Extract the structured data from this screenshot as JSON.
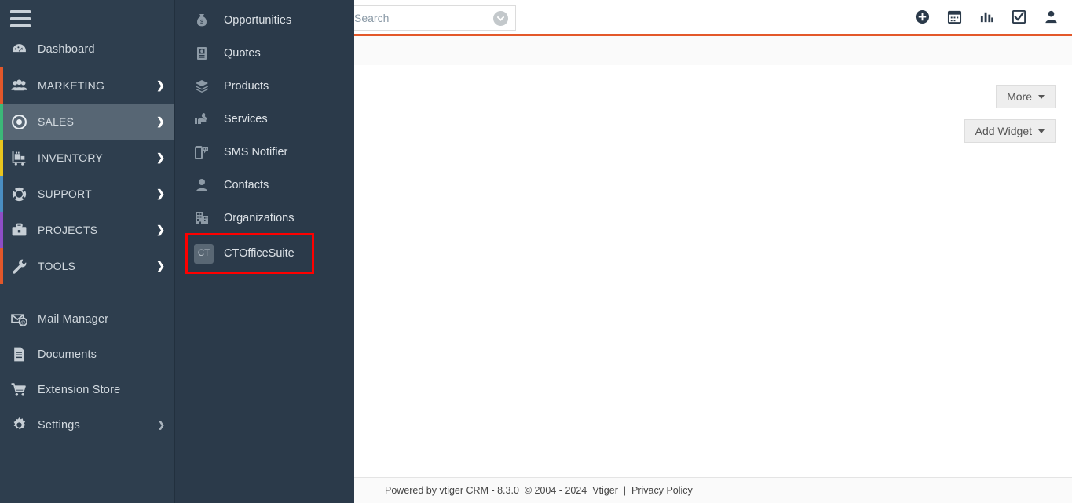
{
  "colors": {
    "accent_orange": "#e3582a",
    "sidebar_bg": "#2e3e4e",
    "submenu_bg": "#2b3a4a",
    "active_item_bg": "#576674",
    "highlight_box": "#ff0000"
  },
  "header": {
    "search": {
      "placeholder": "Search",
      "value": "",
      "visible_text": "arch",
      "dropdown_icon": "chevron-down-circle-icon"
    },
    "icons": [
      {
        "name": "add-record-icon",
        "title": "Add"
      },
      {
        "name": "calendar-icon",
        "title": "Calendar"
      },
      {
        "name": "analytics-icon",
        "title": "Analytics"
      },
      {
        "name": "tasks-checkbox-icon",
        "title": "Tasks"
      },
      {
        "name": "user-profile-icon",
        "title": "Profile"
      }
    ]
  },
  "sidebar": {
    "menu_toggle": "hamburger-icon",
    "items": [
      {
        "label": "Dashboard",
        "icon": "dashboard-gauge-icon",
        "bar": "",
        "chevron": false,
        "active": false,
        "caps": false
      },
      {
        "label": "MARKETING",
        "icon": "marketing-people-icon",
        "bar": "#e2572a",
        "chevron": true,
        "active": false,
        "caps": true
      },
      {
        "label": "SALES",
        "icon": "sales-target-icon",
        "bar": "#3cb878",
        "chevron": true,
        "active": true,
        "caps": true
      },
      {
        "label": "INVENTORY",
        "icon": "inventory-truck-icon",
        "bar": "#e8c51e",
        "chevron": true,
        "active": false,
        "caps": true
      },
      {
        "label": "SUPPORT",
        "icon": "support-lifebuoy-icon",
        "bar": "#4a8ec2",
        "chevron": true,
        "active": false,
        "caps": true
      },
      {
        "label": "PROJECTS",
        "icon": "projects-briefcase-icon",
        "bar": "#8e4ec6",
        "chevron": true,
        "active": false,
        "caps": true
      },
      {
        "label": "TOOLS",
        "icon": "tools-wrench-icon",
        "bar": "#e2572a",
        "chevron": true,
        "active": false,
        "caps": true
      }
    ],
    "bottom_items": [
      {
        "label": "Mail Manager",
        "icon": "mail-at-icon",
        "chevron": false
      },
      {
        "label": "Documents",
        "icon": "documents-file-icon",
        "chevron": false
      },
      {
        "label": "Extension Store",
        "icon": "extension-store-cart-icon",
        "chevron": false
      },
      {
        "label": "Settings",
        "icon": "settings-gear-icon",
        "chevron": true
      }
    ]
  },
  "submenu": {
    "parent": "SALES",
    "items": [
      {
        "label": "Opportunities",
        "icon": "money-bag-icon",
        "highlighted": false
      },
      {
        "label": "Quotes",
        "icon": "quote-document-icon",
        "highlighted": false
      },
      {
        "label": "Products",
        "icon": "products-box-icon",
        "highlighted": false
      },
      {
        "label": "Services",
        "icon": "services-hand-wrench-icon",
        "highlighted": false
      },
      {
        "label": "SMS Notifier",
        "icon": "sms-phone-icon",
        "highlighted": false
      },
      {
        "label": "Contacts",
        "icon": "contact-person-icon",
        "highlighted": false
      },
      {
        "label": "Organizations",
        "icon": "organizations-building-icon",
        "highlighted": false
      },
      {
        "label": "CTOfficeSuite",
        "icon": "ct-badge-icon",
        "badge_text": "CT",
        "highlighted": true
      }
    ]
  },
  "main": {
    "more_button": "More",
    "add_widget_button": "Add Widget"
  },
  "footer": {
    "powered_by": "Powered by vtiger CRM - 8.3.0  © 2004 - 2024  Vtiger  |  ",
    "privacy_policy": "Privacy Policy"
  }
}
